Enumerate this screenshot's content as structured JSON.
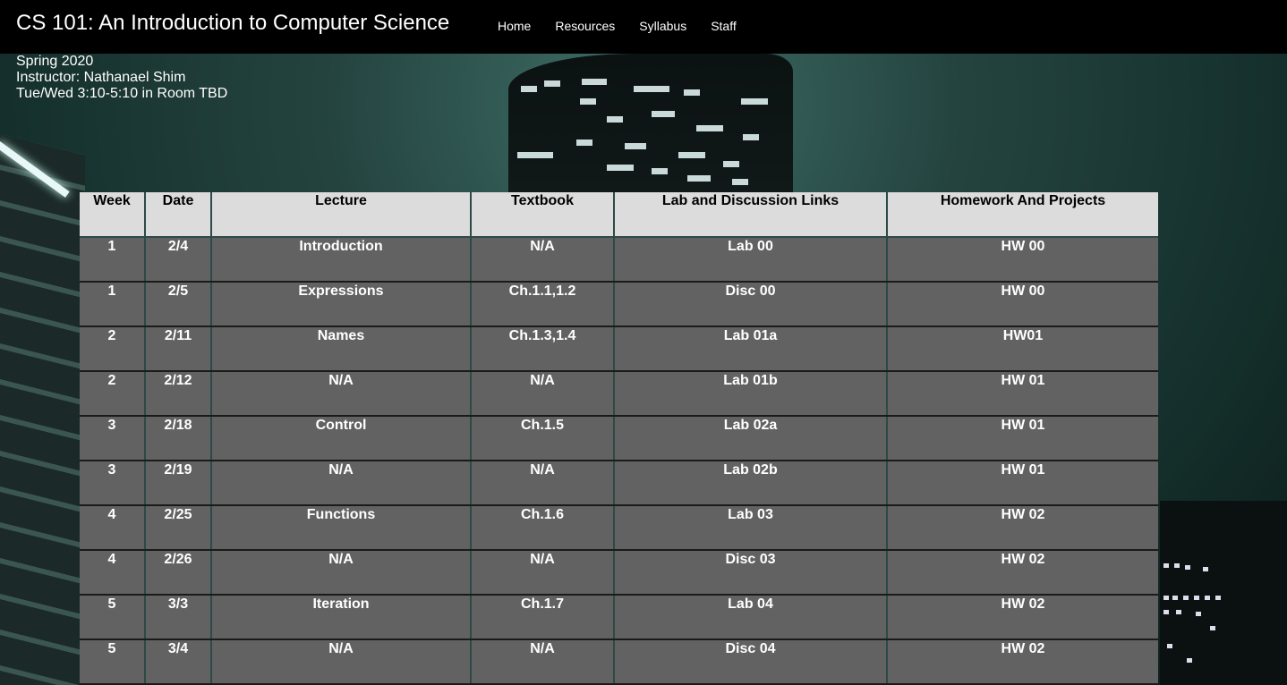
{
  "header": {
    "title": "CS 101: An Introduction to Computer Science",
    "nav": [
      "Home",
      "Resources",
      "Syllabus",
      "Staff"
    ]
  },
  "info": {
    "term": "Spring 2020",
    "instructor": "Instructor: Nathanael Shim",
    "schedule": "Tue/Wed 3:10-5:10 in Room TBD"
  },
  "table": {
    "headers": [
      "Week",
      "Date",
      "Lecture",
      "Textbook",
      "Lab and Discussion Links",
      "Homework And Projects"
    ],
    "rows": [
      [
        "1",
        "2/4",
        "Introduction",
        "N/A",
        "Lab 00",
        "HW 00"
      ],
      [
        "1",
        "2/5",
        "Expressions",
        "Ch.1.1,1.2",
        "Disc 00",
        "HW 00"
      ],
      [
        "2",
        "2/11",
        "Names",
        "Ch.1.3,1.4",
        "Lab 01a",
        "HW01"
      ],
      [
        "2",
        "2/12",
        "N/A",
        "N/A",
        "Lab 01b",
        "HW 01"
      ],
      [
        "3",
        "2/18",
        "Control",
        "Ch.1.5",
        "Lab 02a",
        "HW 01"
      ],
      [
        "3",
        "2/19",
        "N/A",
        "N/A",
        "Lab 02b",
        "HW 01"
      ],
      [
        "4",
        "2/25",
        "Functions",
        "Ch.1.6",
        "Lab 03",
        "HW 02"
      ],
      [
        "4",
        "2/26",
        "N/A",
        "N/A",
        "Disc 03",
        "HW 02"
      ],
      [
        "5",
        "3/3",
        "Iteration",
        "Ch.1.7",
        "Lab 04",
        "HW 02"
      ],
      [
        "5",
        "3/4",
        "N/A",
        "N/A",
        "Disc 04",
        "HW 02"
      ]
    ]
  }
}
